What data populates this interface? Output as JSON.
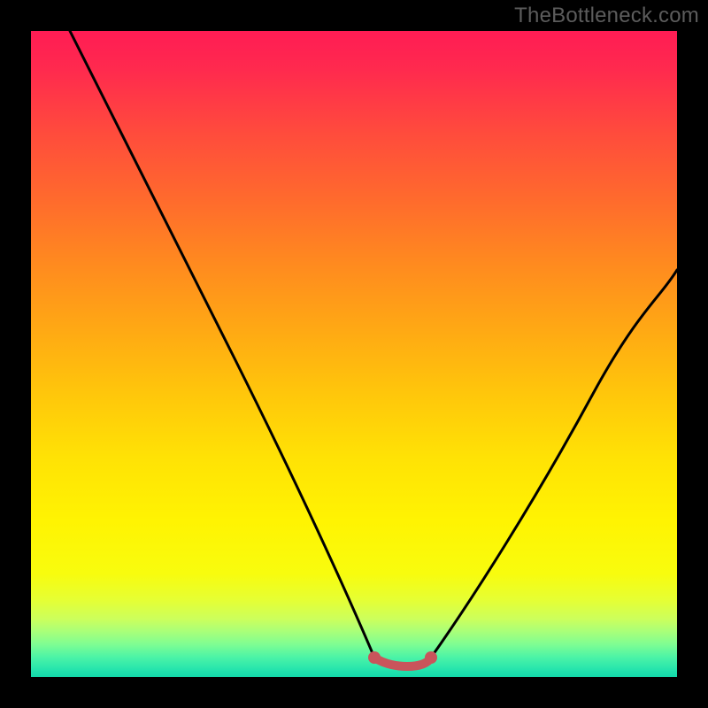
{
  "watermark": "TheBottleneck.com",
  "chart_data": {
    "type": "line",
    "title": "",
    "xlabel": "",
    "ylabel": "",
    "xlim": [
      0,
      100
    ],
    "ylim": [
      0,
      100
    ],
    "series": [
      {
        "name": "left-curve",
        "x": [
          6,
          10,
          15,
          20,
          25,
          30,
          35,
          40,
          45,
          50,
          53
        ],
        "values": [
          100,
          91,
          80,
          69,
          58,
          47,
          36,
          26,
          16,
          7,
          3
        ]
      },
      {
        "name": "right-curve",
        "x": [
          62,
          65,
          70,
          75,
          80,
          85,
          90,
          95,
          100
        ],
        "values": [
          3,
          6,
          13,
          21,
          30,
          39,
          48,
          56,
          63
        ]
      },
      {
        "name": "valley-marker",
        "x": [
          53,
          55,
          57,
          59,
          61,
          62
        ],
        "values": [
          3,
          2,
          2,
          2,
          2,
          3
        ]
      }
    ],
    "gradient_stops": [
      {
        "pct": 0,
        "color": "#ff1c54"
      },
      {
        "pct": 26,
        "color": "#ff6a2d"
      },
      {
        "pct": 56,
        "color": "#ffc60b"
      },
      {
        "pct": 84,
        "color": "#f8fc0e"
      },
      {
        "pct": 97,
        "color": "#4af3a7"
      },
      {
        "pct": 100,
        "color": "#12d9aa"
      }
    ]
  }
}
